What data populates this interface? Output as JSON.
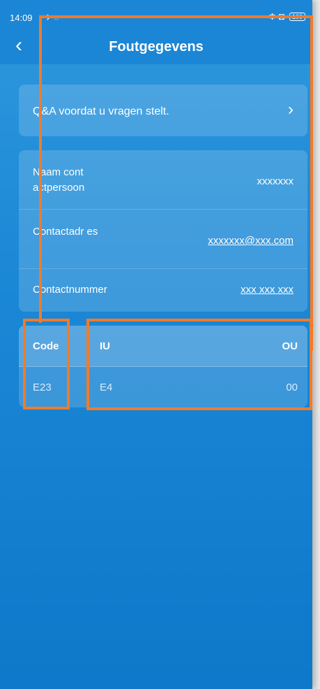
{
  "status_bar": {
    "time": "14:09",
    "icons": "✈ ◌",
    "right_icons": "✱ ⊠",
    "battery": "100"
  },
  "header": {
    "title": "Foutgegevens"
  },
  "faq": {
    "label": "Q&A voordat u vragen stelt."
  },
  "contact": {
    "rows": [
      {
        "label": "Naam cont actpersoon",
        "value": "xxxxxxx"
      },
      {
        "label": "Contactadr es",
        "value": "xxxxxxx@xxx.com"
      },
      {
        "label": "Contactnummer",
        "value": "xxx xxx xxx"
      }
    ]
  },
  "codes": {
    "headers": [
      "Code",
      "IU",
      "OU"
    ],
    "row": [
      "E23",
      "E4",
      "00"
    ]
  },
  "colors": {
    "background": "#1b88d6",
    "highlight": "#f07b2b"
  }
}
